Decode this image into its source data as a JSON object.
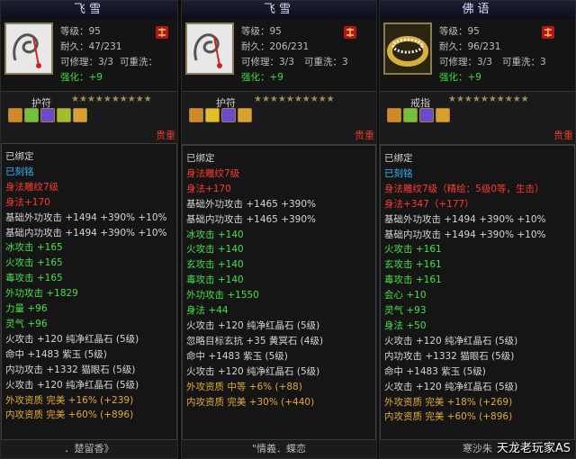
{
  "watermark": "天龙老玩家AS",
  "colors": {
    "title": "#d9d9ff",
    "green_stat": "#3be03b",
    "rare": "#e03a2a"
  },
  "panels": [
    {
      "title": "飞雪",
      "item_type": "护符",
      "level": "等级：95",
      "durability": "耐久：47/231",
      "repair": "可修理：3/3",
      "rewash": "可重洗：",
      "strength": "强化：+9",
      "stars": "★★★★★★★★★★",
      "rarity": "贵重",
      "footer": "．楚留香》",
      "lines": [
        {
          "t": "已绑定",
          "c": "white"
        },
        {
          "t": "已刻铭",
          "c": "blue"
        },
        {
          "t": "身法雕纹7级",
          "c": "red"
        },
        {
          "t": "身法+170",
          "c": "red"
        },
        {
          "t": "基础外功攻击 +1494 +390% +10%",
          "c": "white"
        },
        {
          "t": "基础内功攻击 +1494 +390% +10%",
          "c": "white"
        },
        {
          "t": "冰攻击 +165",
          "c": "green"
        },
        {
          "t": "火攻击 +165",
          "c": "green"
        },
        {
          "t": "毒攻击 +165",
          "c": "green"
        },
        {
          "t": "外功攻击 +1829",
          "c": "green"
        },
        {
          "t": "力量 +96",
          "c": "green"
        },
        {
          "t": "灵气 +96",
          "c": "green"
        },
        {
          "t": "火攻击 +120 纯净红晶石 (5级)",
          "c": "white"
        },
        {
          "t": "命中 +1483 紫玉 (5级)",
          "c": "white"
        },
        {
          "t": "内功攻击 +1332 猫眼石 (5级)",
          "c": "white"
        },
        {
          "t": "火攻击 +120 纯净红晶石 (5级)",
          "c": "white"
        },
        {
          "t": "外攻资质 完美 +16% (+239)",
          "c": "gold"
        },
        {
          "t": "内攻资质 完美 +60% (+896)",
          "c": "gold"
        }
      ]
    },
    {
      "title": "飞雪",
      "item_type": "护符",
      "level": "等级：95",
      "durability": "耐久：206/231",
      "repair": "可修理：3/3",
      "rewash": "可重洗：3",
      "strength": "强化：+9",
      "stars": "★★★★★★★★★★",
      "rarity": "贵重",
      "footer": "\"情義．蝶恋",
      "lines": [
        {
          "t": "已绑定",
          "c": "white"
        },
        {
          "t": "身法雕纹7级",
          "c": "red"
        },
        {
          "t": "身法+170",
          "c": "red"
        },
        {
          "t": "基础外功攻击 +1465 +390%",
          "c": "white"
        },
        {
          "t": "基础内功攻击 +1465 +390%",
          "c": "white"
        },
        {
          "t": "冰攻击 +140",
          "c": "green"
        },
        {
          "t": "火攻击 +140",
          "c": "green"
        },
        {
          "t": "玄攻击 +140",
          "c": "green"
        },
        {
          "t": "毒攻击 +140",
          "c": "green"
        },
        {
          "t": "外功攻击 +1550",
          "c": "green"
        },
        {
          "t": "身法 +44",
          "c": "green"
        },
        {
          "t": "火攻击 +120 纯净红晶石 (5级)",
          "c": "white"
        },
        {
          "t": "忽略目标玄抗 +35 黄冥石 (4级)",
          "c": "white"
        },
        {
          "t": "命中 +1483 紫玉 (5级)",
          "c": "white"
        },
        {
          "t": "火攻击 +120 纯净红晶石 (5级)",
          "c": "white"
        },
        {
          "t": "外攻资质 中等 +6% (+88)",
          "c": "gold"
        },
        {
          "t": "内攻资质 完美 +30% (+440)",
          "c": "gold"
        }
      ]
    },
    {
      "title": "佛语",
      "item_type": "戒指",
      "level": "等级：95",
      "durability": "耐久：96/231",
      "repair": "可修理：3/3",
      "rewash": "可重洗：3",
      "strength": "强化：+9",
      "stars": "★★★★★★★★★★",
      "rarity": "贵重",
      "footer": "寒沙朱",
      "lines": [
        {
          "t": "已绑定",
          "c": "white"
        },
        {
          "t": "已刻铭",
          "c": "blue"
        },
        {
          "t": "身法雕纹7级（精绘：5级0等，生击）",
          "c": "red"
        },
        {
          "t": "身法+347（+177）",
          "c": "red"
        },
        {
          "t": "基础外功攻击 +1494 +390% +10%",
          "c": "white"
        },
        {
          "t": "基础内功攻击 +1494 +390% +10%",
          "c": "white"
        },
        {
          "t": "火攻击 +161",
          "c": "green"
        },
        {
          "t": "玄攻击 +161",
          "c": "green"
        },
        {
          "t": "毒攻击 +161",
          "c": "green"
        },
        {
          "t": "会心 +10",
          "c": "green"
        },
        {
          "t": "灵气 +93",
          "c": "green"
        },
        {
          "t": "身法 +50",
          "c": "green"
        },
        {
          "t": "火攻击 +120 纯净红晶石 (5级)",
          "c": "white"
        },
        {
          "t": "内功攻击 +1332 猫眼石 (5级)",
          "c": "white"
        },
        {
          "t": "命中 +1483 紫玉 (5级)",
          "c": "white"
        },
        {
          "t": "火攻击 +120 纯净红晶石 (5级)",
          "c": "white"
        },
        {
          "t": "外攻资质 完美 +18% (+269)",
          "c": "gold"
        },
        {
          "t": "内攻资质 完美 +60% (+896)",
          "c": "gold"
        }
      ]
    }
  ]
}
